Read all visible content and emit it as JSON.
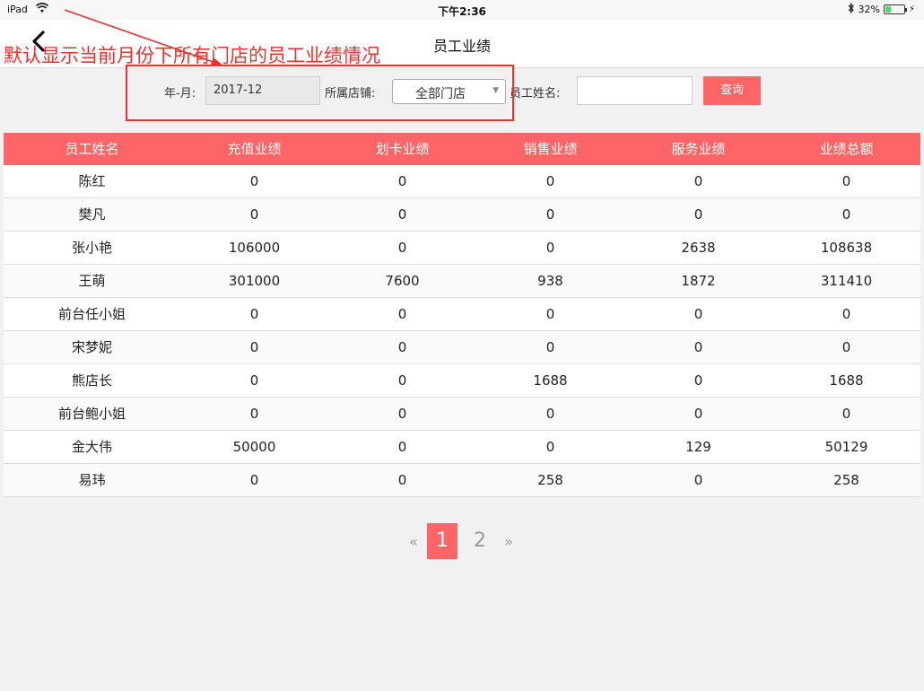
{
  "status_bar": {
    "carrier": "iPad",
    "time": "下午2:36",
    "battery_text": "32%",
    "battery_level": 0.32,
    "wifi_icon": "wifi-icon",
    "bluetooth_icon": "bluetooth-icon"
  },
  "nav": {
    "title": "员工业绩",
    "back_icon": "chevron-left-icon"
  },
  "annotation": {
    "text": "默认显示当前月份下所有门店的员工业绩情况",
    "color": "#e83232"
  },
  "filters": {
    "month_label": "年-月:",
    "month_value": "2017-12",
    "store_label": "所属店铺:",
    "store_value": "全部门店",
    "name_label": "员工姓名:",
    "name_value": "",
    "query_label": "查询"
  },
  "table": {
    "headers": [
      "员工姓名",
      "充值业绩",
      "划卡业绩",
      "销售业绩",
      "服务业绩",
      "业绩总额"
    ],
    "rows": [
      [
        "陈红",
        "0",
        "0",
        "0",
        "0",
        "0"
      ],
      [
        "樊凡",
        "0",
        "0",
        "0",
        "0",
        "0"
      ],
      [
        "张小艳",
        "106000",
        "0",
        "0",
        "2638",
        "108638"
      ],
      [
        "王萌",
        "301000",
        "7600",
        "938",
        "1872",
        "311410"
      ],
      [
        "前台任小姐",
        "0",
        "0",
        "0",
        "0",
        "0"
      ],
      [
        "宋梦妮",
        "0",
        "0",
        "0",
        "0",
        "0"
      ],
      [
        "熊店长",
        "0",
        "0",
        "1688",
        "0",
        "1688"
      ],
      [
        "前台鲍小姐",
        "0",
        "0",
        "0",
        "0",
        "0"
      ],
      [
        "金大伟",
        "50000",
        "0",
        "0",
        "129",
        "50129"
      ],
      [
        "易玮",
        "0",
        "0",
        "258",
        "0",
        "258"
      ]
    ]
  },
  "pagination": {
    "prev": "«",
    "pages": [
      "1",
      "2"
    ],
    "current": "1",
    "next": "»"
  },
  "colors": {
    "accent": "#fe6567",
    "background": "#f1f1f1"
  }
}
